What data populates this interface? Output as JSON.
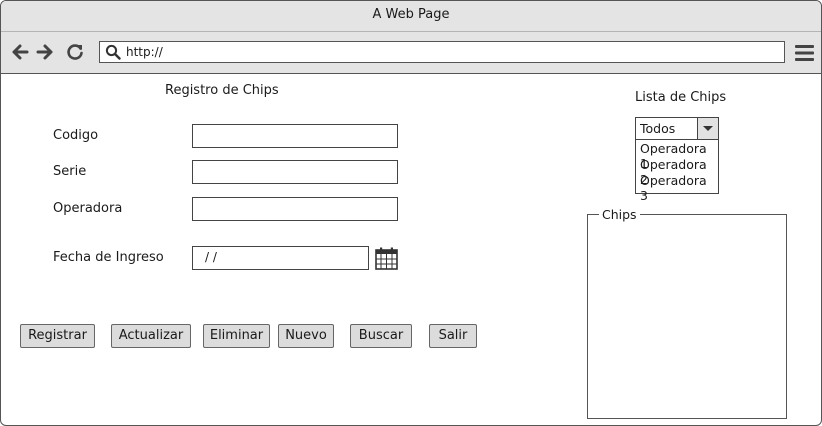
{
  "window": {
    "title": "A Web Page"
  },
  "browser": {
    "url": "http://"
  },
  "form": {
    "title": "Registro de Chips",
    "codigo_label": "Codigo",
    "codigo_value": "",
    "serie_label": "Serie",
    "serie_value": "",
    "operadora_label": "Operadora",
    "operadora_value": "",
    "fecha_label": "Fecha de Ingreso",
    "fecha_value": "/ /"
  },
  "buttons": {
    "registrar": "Registrar",
    "actualizar": "Actualizar",
    "eliminar": "Eliminar",
    "nuevo": "Nuevo",
    "buscar": "Buscar",
    "salir": "Salir"
  },
  "list": {
    "title": "Lista de Chips",
    "selected": "Todos",
    "options": [
      "Operadora 1",
      "Operadora 2",
      "Operadora 3"
    ],
    "group_label": "Chips"
  },
  "icons": {
    "back": "back-arrow-icon",
    "forward": "forward-arrow-icon",
    "reload": "reload-icon",
    "search": "search-icon",
    "menu": "hamburger-menu-icon",
    "calendar": "calendar-icon",
    "dropdown": "chevron-down-icon"
  }
}
